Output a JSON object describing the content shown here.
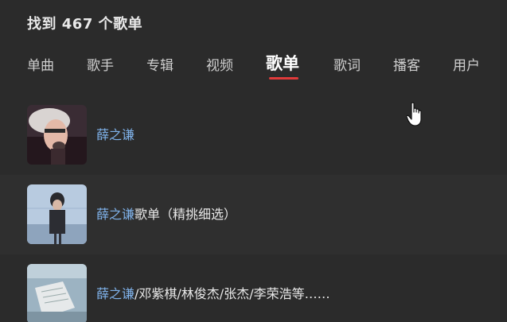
{
  "header": {
    "title": "找到 467 个歌单"
  },
  "tabs": [
    {
      "label": "单曲"
    },
    {
      "label": "歌手"
    },
    {
      "label": "专辑"
    },
    {
      "label": "视频"
    },
    {
      "label": "歌单"
    },
    {
      "label": "歌词"
    },
    {
      "label": "播客"
    },
    {
      "label": "用户"
    }
  ],
  "active_tab_index": 4,
  "colors": {
    "accent_underline": "#e03a3a",
    "highlight_text": "#7fb2ea",
    "background": "#2b2b2b"
  },
  "playlists": [
    {
      "highlight": "薛之谦",
      "rest": ""
    },
    {
      "highlight": "薛之谦",
      "rest": "歌单（精挑细选）"
    },
    {
      "highlight": "薛之谦",
      "rest": "/邓紫棋/林俊杰/张杰/李荣浩等……"
    }
  ],
  "cursor": {
    "icon": "hand-pointer-icon"
  }
}
